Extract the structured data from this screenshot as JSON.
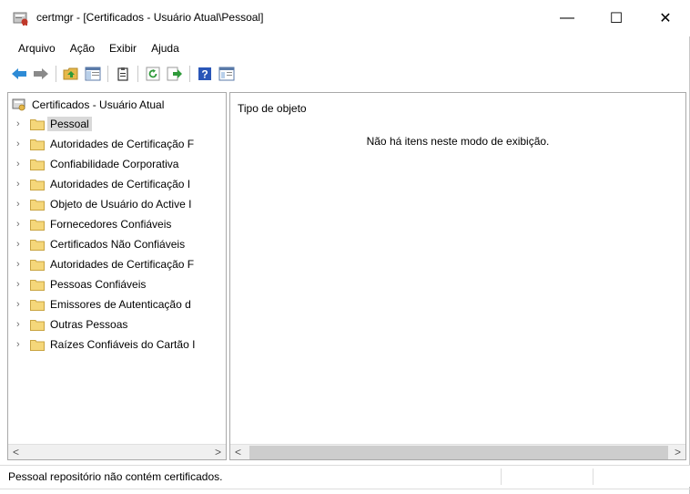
{
  "window": {
    "title": "certmgr - [Certificados - Usuário Atual\\Pessoal]",
    "app_icon": "certmgr-icon",
    "controls": {
      "minimize": "—",
      "maximize": "☐",
      "close": "✕"
    }
  },
  "menu": {
    "items": [
      "Arquivo",
      "Ação",
      "Exibir",
      "Ajuda"
    ]
  },
  "toolbar": {
    "buttons": [
      "back-icon",
      "forward-icon",
      "up-folder-icon",
      "show-hide-tree-icon",
      "export-list-icon",
      "refresh-icon",
      "export-icon",
      "help-icon",
      "properties-icon"
    ]
  },
  "tree": {
    "root": "Certificados - Usuário Atual",
    "items": [
      {
        "label": "Pessoal",
        "selected": true
      },
      {
        "label": "Autoridades de Certificação F"
      },
      {
        "label": "Confiabilidade Corporativa"
      },
      {
        "label": "Autoridades de Certificação I"
      },
      {
        "label": "Objeto de Usuário do Active I"
      },
      {
        "label": "Fornecedores Confiáveis"
      },
      {
        "label": "Certificados Não Confiáveis"
      },
      {
        "label": "Autoridades de Certificação F"
      },
      {
        "label": "Pessoas Confiáveis"
      },
      {
        "label": "Emissores de Autenticação d"
      },
      {
        "label": "Outras Pessoas"
      },
      {
        "label": "Raízes Confiáveis do Cartão I"
      }
    ]
  },
  "details": {
    "column_header": "Tipo de objeto",
    "empty_message": "Não há itens neste modo de exibição."
  },
  "scroll": {
    "left_arrow": "<",
    "right_arrow": ">"
  },
  "status": {
    "text": "Pessoal repositório não contém certificados."
  }
}
